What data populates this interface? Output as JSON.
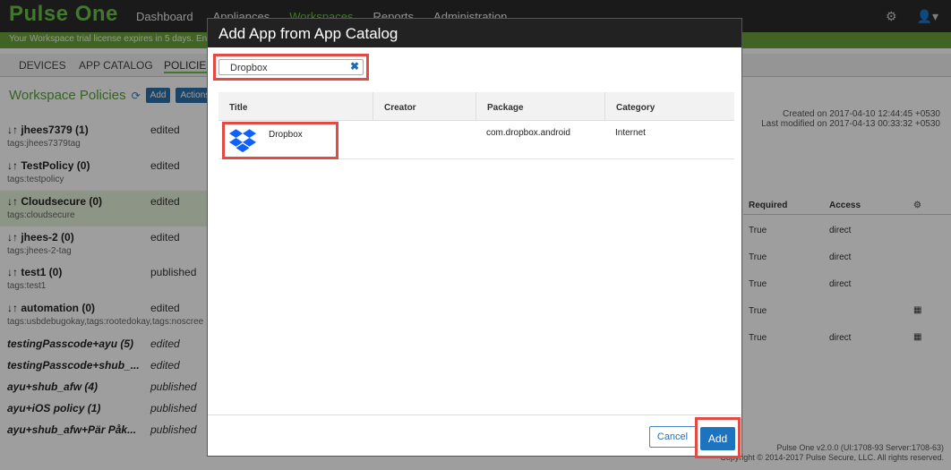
{
  "app": {
    "logo": "Pulse One",
    "nav": [
      "Dashboard",
      "Appliances",
      "Workspaces",
      "Reports",
      "Administration"
    ],
    "active_nav_index": 2,
    "settings_icon": "gear-icon",
    "user_icon": "user-icon"
  },
  "trial": {
    "text": "Your Workspace trial license expires in 5 days.  En"
  },
  "subtabs": [
    "DEVICES",
    "APP CATALOG",
    "POLICIES"
  ],
  "workspace": {
    "title": "Workspace Policies",
    "add_label": "Add",
    "actions_label": "Actions ▾"
  },
  "policies": [
    {
      "name": "↓↑ jhees7379 (1)",
      "tag": "tags:jhees7379tag",
      "status": "edited",
      "italic": false,
      "highlight": false
    },
    {
      "name": "↓↑ TestPolicy (0)",
      "tag": "tags:testpolicy",
      "status": "edited",
      "italic": false,
      "highlight": false
    },
    {
      "name": "↓↑ Cloudsecure (0)",
      "tag": "tags:cloudsecure",
      "status": "edited",
      "italic": false,
      "highlight": true
    },
    {
      "name": "↓↑ jhees-2 (0)",
      "tag": "tags:jhees-2-tag",
      "status": "edited",
      "italic": false,
      "highlight": false
    },
    {
      "name": "↓↑ test1 (0)",
      "tag": "tags:test1",
      "status": "published",
      "italic": false,
      "highlight": false
    },
    {
      "name": "↓↑ automation (0)",
      "tag": "tags:usbdebugokay,tags:rootedokay,tags:noscree",
      "status": "edited",
      "italic": false,
      "highlight": false
    },
    {
      "name": "testingPasscode+ayu (5)",
      "tag": "",
      "status": "edited",
      "italic": true,
      "highlight": false
    },
    {
      "name": "testingPasscode+shub_...",
      "tag": "",
      "status": "edited",
      "italic": true,
      "highlight": false
    },
    {
      "name": "ayu+shub_afw (4)",
      "tag": "",
      "status": "published",
      "italic": true,
      "highlight": false
    },
    {
      "name": "ayu+iOS policy (1)",
      "tag": "",
      "status": "published",
      "italic": true,
      "highlight": false
    },
    {
      "name": "ayu+shub_afw+Pär Påk...",
      "tag": "",
      "status": "published",
      "italic": true,
      "highlight": false
    }
  ],
  "meta": {
    "created": "Created on 2017-04-10 12:44:45 +0530",
    "modified": "Last modified on 2017-04-13 00:33:32 +0530"
  },
  "right_table": {
    "headers": [
      "Required",
      "Access"
    ],
    "rows": [
      {
        "required": "True",
        "access": "direct",
        "grid": false
      },
      {
        "required": "True",
        "access": "direct",
        "grid": false
      },
      {
        "required": "True",
        "access": "direct",
        "grid": false
      },
      {
        "required": "True",
        "access": "",
        "grid": true
      },
      {
        "required": "True",
        "access": "direct",
        "grid": true
      }
    ]
  },
  "footer": {
    "version": "Pulse One v2.0.0 (UI:1708-93 Server:1708-63)",
    "copyright": "Copyright © 2014-2017 Pulse Secure, LLC. All rights reserved."
  },
  "modal": {
    "title": "Add App from App Catalog",
    "search_value": "Dropbox",
    "clear_icon": "close-icon",
    "columns": [
      "Title",
      "Creator",
      "Package",
      "Category"
    ],
    "rows": [
      {
        "title": "Dropbox",
        "creator": "",
        "package": "com.dropbox.android",
        "category": "Internet",
        "icon": "dropbox-icon"
      }
    ],
    "cancel_label": "Cancel",
    "add_label": "Add"
  },
  "colors": {
    "brand_green": "#6cc04a",
    "primary_blue": "#1e73be",
    "highlight_red": "#e24b43"
  }
}
